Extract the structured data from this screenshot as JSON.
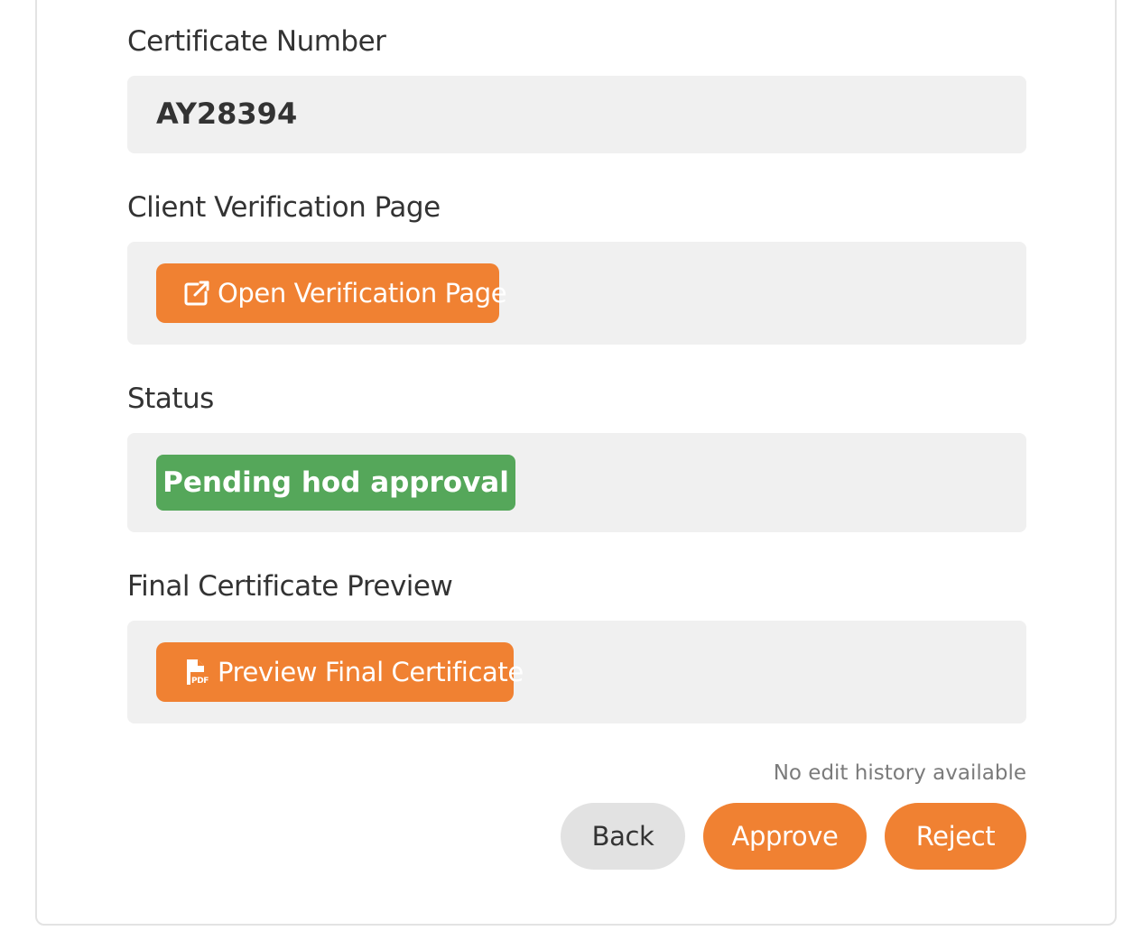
{
  "fields": {
    "certificate_number": {
      "label": "Certificate Number",
      "value": "AY28394"
    },
    "verification": {
      "label": "Client Verification Page",
      "button_label": "Open Verification Page",
      "button_icon": "external-link-icon"
    },
    "status": {
      "label": "Status",
      "value": "Pending hod approval",
      "color": "#55a75a"
    },
    "preview": {
      "label": "Final Certificate Preview",
      "button_label": "Preview Final Certificate",
      "button_icon": "pdf-file-icon"
    }
  },
  "history_note": "No edit history available",
  "actions": {
    "back": "Back",
    "approve": "Approve",
    "reject": "Reject"
  },
  "colors": {
    "accent": "#f08132",
    "success": "#55a75a",
    "panel": "#f0f0f0"
  }
}
